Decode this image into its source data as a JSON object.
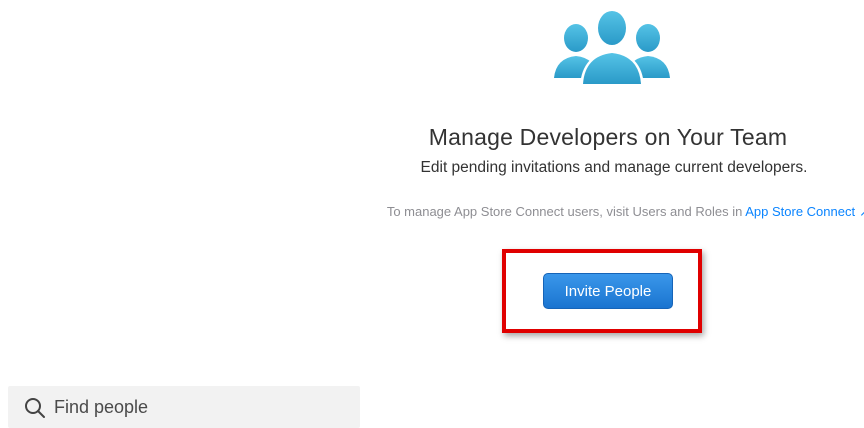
{
  "header": {
    "icon": "team-people-icon",
    "title": "Manage Developers on Your Team",
    "subtitle": "Edit pending invitations and manage current developers."
  },
  "asc_note": {
    "text": "To manage App Store Connect users, visit Users and Roles in",
    "link_label": "App Store Connect",
    "link_icon": "external-link-arrow-icon"
  },
  "actions": {
    "invite_label": "Invite People"
  },
  "search": {
    "placeholder": "Find people",
    "value": "",
    "icon": "search-icon"
  },
  "colors": {
    "accent": "#0a84ff",
    "button": "#1a74d0",
    "highlight": "#e00000",
    "icon_teal": "#3fb0d8"
  }
}
